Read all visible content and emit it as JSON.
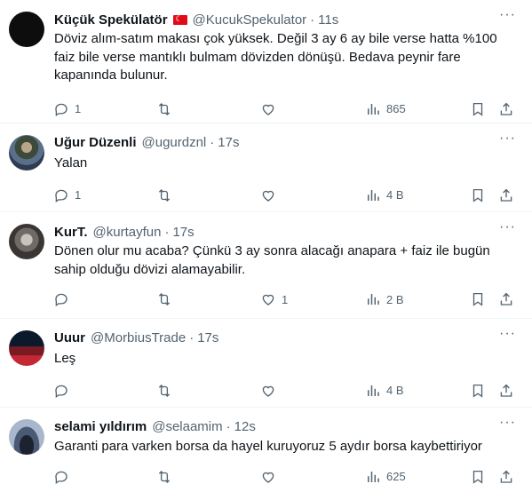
{
  "tweets": [
    {
      "name": "Küçük Spekülatör",
      "flag": true,
      "handle": "@KucukSpekulator",
      "time": "11s",
      "text": "Döviz alım-satım makası çok yüksek. Değil 3 ay 6 ay bile verse hatta %100 faiz bile verse mantıklı bulmam dövizden dönüşü.  Bedava peynir fare kapanında bulunur.",
      "replies": "1",
      "retweets": "",
      "likes": "",
      "views": "865"
    },
    {
      "name": "Uğur Düzenli",
      "handle": "@ugurdznl",
      "time": "17s",
      "text": "Yalan",
      "replies": "1",
      "retweets": "",
      "likes": "",
      "views": "4 B"
    },
    {
      "name": "KurT.",
      "handle": "@kurtayfun",
      "time": "17s",
      "text": "Dönen olur mu acaba? Çünkü 3 ay sonra alacağı anapara + faiz ile bugün sahip olduğu dövizi alamayabilir.",
      "replies": "",
      "retweets": "",
      "likes": "1",
      "views": "2 B"
    },
    {
      "name": "Uuur",
      "handle": "@MorbiusTrade",
      "time": "17s",
      "text": "Leş",
      "replies": "",
      "retweets": "",
      "likes": "",
      "views": "4 B"
    },
    {
      "name": "selami yıldırım",
      "handle": "@selaamim",
      "time": "12s",
      "text": "Garanti para varken borsa da hayel kuruyoruz 5 aydır borsa kaybettiriyor",
      "replies": "",
      "retweets": "",
      "likes": "",
      "views": "625"
    }
  ],
  "colors": {
    "text": "#0f1419",
    "muted": "#536471",
    "divider": "#eff3f4"
  },
  "icons": [
    "reply-icon",
    "retweet-icon",
    "like-icon",
    "views-icon",
    "bookmark-icon",
    "share-icon",
    "more-icon"
  ]
}
